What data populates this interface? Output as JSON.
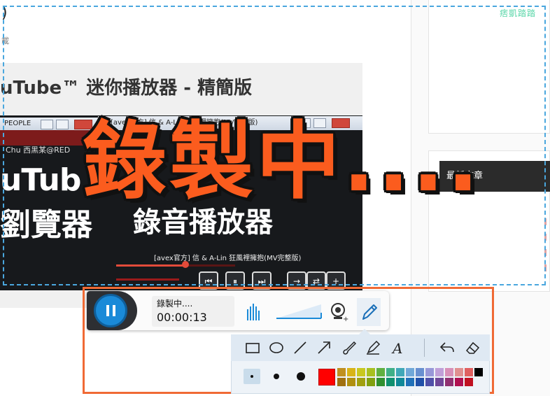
{
  "background_page": {
    "corner_paren": ")",
    "corner_char": "載",
    "site_watermark": "痞凱踏踏",
    "latest_posts": "最新文章"
  },
  "article_image": {
    "title": "uTube™ 迷你播放器 - 精簡版",
    "left_window_title": "PEOPLE",
    "right_window_title": "[avex官方] 信 & A-Lin 狂風裡擁抱(MV完整版)",
    "user_text": "Chu 西黑某@RED",
    "big_text_line1": "uTub",
    "big_text_line2": "劉覽器",
    "big_text_right": "錄音播放器",
    "video_caption": "[avex官方] 信 & A-Lin 狂風裡擁抱(MV完整版)",
    "seek_fraction": 0.58
  },
  "overlay": {
    "big_text": "錄製中....",
    "accent_color": "#fb5c1e"
  },
  "recorder": {
    "status_label": "錄製中....",
    "timer": "00:00:13",
    "pause_icon": "pause-icon",
    "audio_icon": "audio-meter-icon",
    "webcam_icon": "webcam-icon",
    "pen_icon": "pen-icon",
    "pause_color": "#1a8ad8"
  },
  "draw_tools": {
    "tools": [
      "rectangle-icon",
      "ellipse-icon",
      "line-icon",
      "arrow-icon",
      "brush-icon",
      "highlighter-icon",
      "text-icon",
      "undo-icon",
      "eraser-icon"
    ],
    "text_tool_glyph": "A",
    "selected_color": "#ff0000",
    "palette_top": [
      "#c09020",
      "#d8b418",
      "#c8c820",
      "#a8c020",
      "#60b040",
      "#40b088",
      "#40a8b8",
      "#70a8d8",
      "#6890d0",
      "#9898d8",
      "#c0a0d8",
      "#d890b8",
      "#e09090",
      "#e06060"
    ],
    "palette_bottom": [
      "#a07010",
      "#b09010",
      "#a0a010",
      "#80a010",
      "#309030",
      "#109070",
      "#108898",
      "#2070b8",
      "#2050a8",
      "#5050a8",
      "#704898",
      "#903070",
      "#b01050",
      "#c01020"
    ],
    "palette_black": "#000000"
  }
}
